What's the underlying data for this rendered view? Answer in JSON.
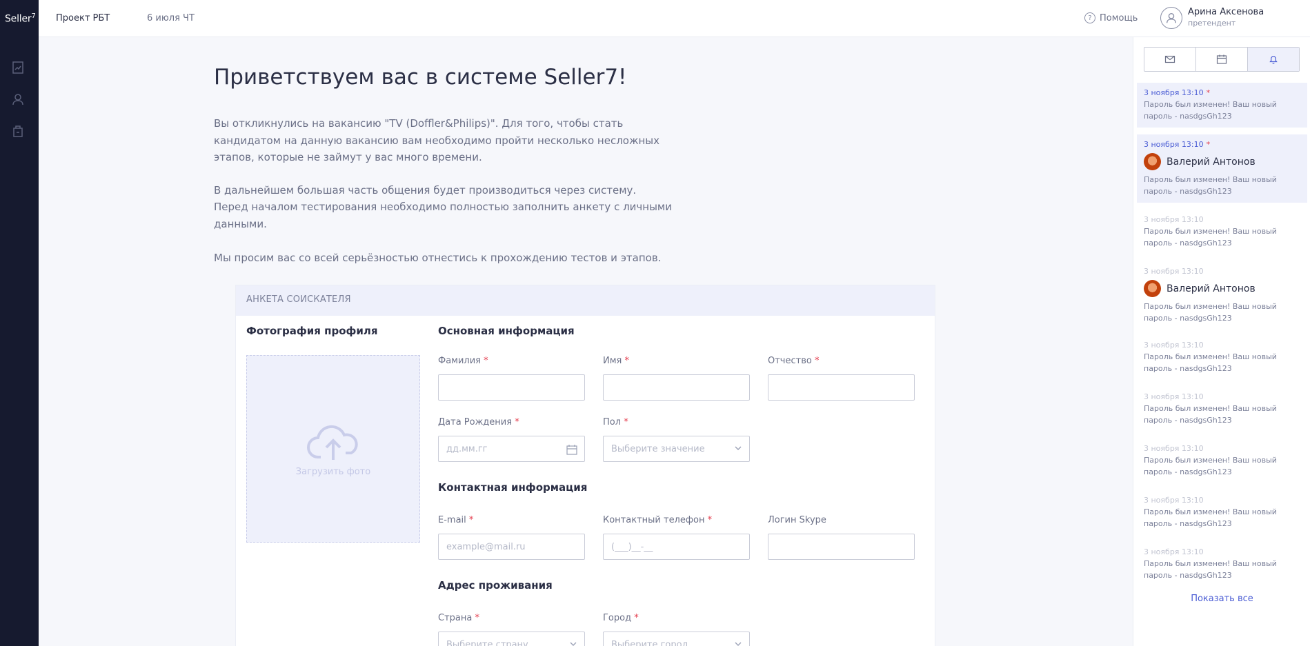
{
  "app": {
    "logo": "Seller",
    "logo_sup": "7",
    "project": "Проект РБТ",
    "date": "6 июля ЧТ",
    "help": "Помощь",
    "user_name": "Арина Аксенова",
    "user_role": "претендент",
    "more": "•••"
  },
  "rail": {
    "icons": [
      "tasks-icon",
      "profile-icon",
      "portfolio-icon"
    ]
  },
  "main": {
    "title": "Приветствуем вас в системе Seller7!",
    "p1": "Вы откликнулись на вакансию \"TV (Doffler&Philips)\". Для того, чтобы стать кандидатом на данную вакансию вам необходимо пройти несколько несложных этапов, которые не займут у вас много времени.",
    "p2a": "В дальнейшем большая часть общения будет производиться через систему.",
    "p2b": "Перед началом тестирования необходимо полностью заполнить анкету с личными данными.",
    "p3": "Мы просим вас со всей серьёзностью отнестись к прохождению тестов и этапов."
  },
  "form": {
    "header": "АНКЕТА СОИСКАТЕЛЯ",
    "photo_title": "Фотография профиля",
    "photo_upload": "Загрузить фото",
    "basic_title": "Основная информация",
    "last_name": "Фамилия",
    "first_name": "Имя",
    "patronymic": "Отчество",
    "birth_date": "Дата Рождения",
    "birth_placeholder": "дд.мм.гг",
    "gender": "Пол",
    "gender_placeholder": "Выберите значение",
    "contact_title": "Контактная информация",
    "email": "E-mail",
    "email_placeholder": "example@mail.ru",
    "phone": "Контактный телефон",
    "phone_placeholder": "(___)__-__",
    "skype": "Логин Skype",
    "address_title": "Адрес проживания",
    "country": "Страна",
    "country_placeholder": "Выберите страну",
    "city": "Город",
    "city_placeholder": "Выберите город",
    "required_mark": "*"
  },
  "notifications": {
    "tabs": [
      "mail-icon",
      "calendar-icon",
      "bell-icon"
    ],
    "items": [
      {
        "time": "3 ноября 13:10",
        "text": "Пароль был изменен! Ваш новый пароль - nasdgsGh123",
        "unread": true
      },
      {
        "time": "3 ноября 13:10",
        "user": "Валерий Антонов",
        "text": "Пароль был изменен! Ваш новый пароль - nasdgsGh123",
        "unread": true
      },
      {
        "time": "3 ноября 13:10",
        "text": "Пароль был изменен! Ваш новый пароль - nasdgsGh123"
      },
      {
        "time": "3 ноября 13:10",
        "user": "Валерий Антонов",
        "text": "Пароль был изменен! Ваш новый пароль - nasdgsGh123"
      },
      {
        "time": "3 ноября 13:10",
        "text": "Пароль был изменен! Ваш новый пароль - nasdgsGh123"
      },
      {
        "time": "3 ноября 13:10",
        "text": "Пароль был изменен! Ваш новый пароль - nasdgsGh123"
      },
      {
        "time": "3 ноября 13:10",
        "text": "Пароль был изменен! Ваш новый пароль - nasdgsGh123"
      },
      {
        "time": "3 ноября 13:10",
        "text": "Пароль был изменен! Ваш новый пароль - nasdgsGh123"
      },
      {
        "time": "3 ноября 13:10",
        "text": "Пароль был изменен! Ваш новый пароль - nasdgsGh123"
      }
    ],
    "show_all": "Показать все"
  }
}
